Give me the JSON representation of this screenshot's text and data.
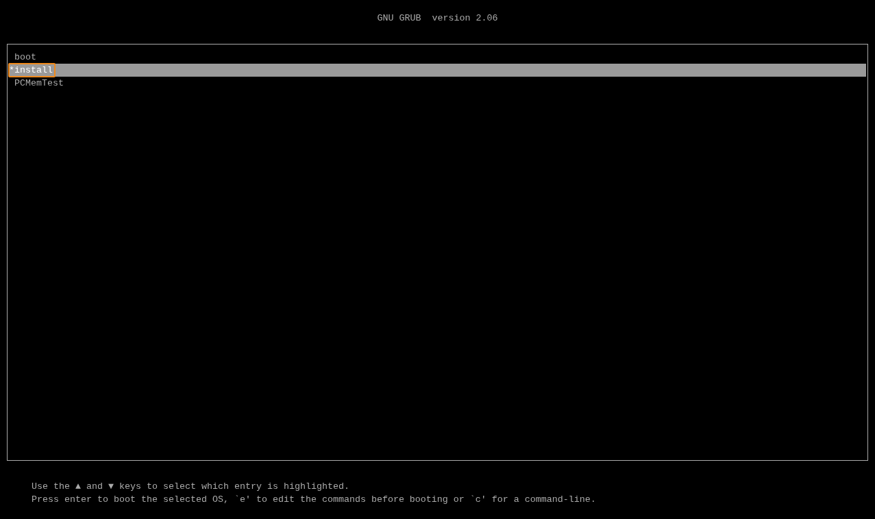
{
  "header": {
    "title": "GNU GRUB  version 2.06"
  },
  "menu": {
    "entries": [
      {
        "label": "boot",
        "selected": false
      },
      {
        "label": "install",
        "selected": true,
        "marker": "*"
      },
      {
        "label": "PCMemTest",
        "selected": false
      }
    ]
  },
  "help": {
    "lines": [
      "Use the ▲ and ▼ keys to select which entry is highlighted.",
      "Press enter to boot the selected OS, `e' to edit the commands before booting or `c' for a command-line."
    ]
  }
}
